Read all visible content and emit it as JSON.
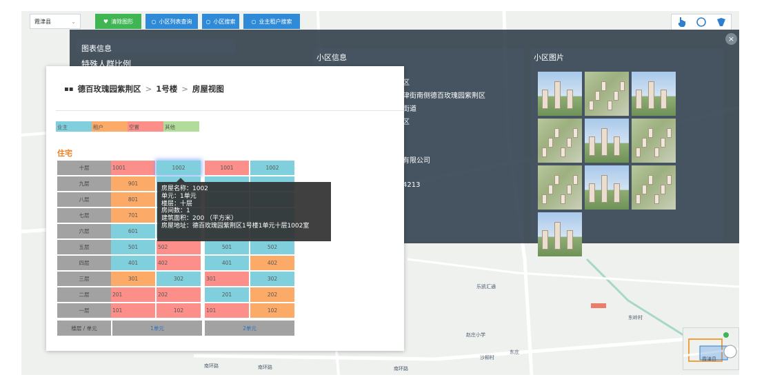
{
  "toolbar": {
    "county": "霞津县",
    "clear_label": "清除图形",
    "list_query_label": "小区列表查询",
    "search_label": "小区搜索",
    "owner_search_label": "业主租户搜索"
  },
  "map_labels": [
    "霞津县",
    "南环路",
    "南环路",
    "南环路",
    "乐凯汇通",
    "赵庄小学",
    "东岭村",
    "沙柳村",
    "东庄",
    "霞津县"
  ],
  "overlay": {
    "chart_info_title": "图表信息",
    "chart_info_subtitle": "特殊人群比例",
    "community_info_title": "小区信息",
    "community_photos_title": "小区图片",
    "info_lines": [
      "区",
      "津街南侧德百玫瑰园紫荆区",
      "街道",
      "区",
      "有限公司",
      "4213"
    ]
  },
  "breadcrumb": {
    "community": "德百玫瑰园紫荆区",
    "building": "1号楼",
    "view": "房屋视图"
  },
  "legend": [
    {
      "label": "业主",
      "color": "#7fd0dc"
    },
    {
      "label": "租户",
      "color": "#fcaa67"
    },
    {
      "label": "空置",
      "color": "#fd8f8a"
    },
    {
      "label": "其他",
      "color": "#b1dc99"
    }
  ],
  "section_title": "住宅",
  "floors": [
    "十层",
    "九层",
    "八层",
    "七层",
    "六层",
    "五层",
    "四层",
    "三层",
    "二层",
    "一层"
  ],
  "room_grid": [
    [
      [
        "1001",
        "vacant",
        "left"
      ],
      [
        "1002",
        "owner",
        "center"
      ],
      [
        "1001",
        "vacant",
        "center"
      ],
      [
        "1002",
        "owner",
        "center"
      ]
    ],
    [
      [
        "901",
        "tenant",
        "center"
      ],
      [
        "",
        "owner",
        "center"
      ],
      [
        "",
        "owner",
        "center"
      ],
      [
        "",
        "owner",
        "center"
      ]
    ],
    [
      [
        "801",
        "tenant",
        "center"
      ],
      [
        "",
        "owner",
        "center"
      ],
      [
        "",
        "owner",
        "center"
      ],
      [
        "",
        "owner",
        "center"
      ]
    ],
    [
      [
        "701",
        "tenant",
        "center"
      ],
      [
        "",
        "owner",
        "center"
      ],
      [
        "",
        "owner",
        "center"
      ],
      [
        "",
        "owner",
        "center"
      ]
    ],
    [
      [
        "601",
        "owner",
        "center"
      ],
      [
        "",
        "owner",
        "center"
      ],
      [
        "",
        "owner",
        "center"
      ],
      [
        "",
        "owner",
        "center"
      ]
    ],
    [
      [
        "501",
        "owner",
        "center"
      ],
      [
        "502",
        "vacant",
        "left"
      ],
      [
        "501",
        "owner",
        "center"
      ],
      [
        "502",
        "owner",
        "center"
      ]
    ],
    [
      [
        "401",
        "owner",
        "center"
      ],
      [
        "402",
        "vacant",
        "left"
      ],
      [
        "401",
        "owner",
        "center"
      ],
      [
        "402",
        "tenant",
        "center"
      ]
    ],
    [
      [
        "301",
        "tenant",
        "center"
      ],
      [
        "302",
        "owner",
        "center"
      ],
      [
        "301",
        "vacant",
        "left"
      ],
      [
        "302",
        "owner",
        "center"
      ]
    ],
    [
      [
        "201",
        "vacant",
        "left"
      ],
      [
        "202",
        "vacant",
        "left"
      ],
      [
        "201",
        "owner",
        "center"
      ],
      [
        "202",
        "tenant",
        "center"
      ]
    ],
    [
      [
        "101",
        "vacant",
        "left"
      ],
      [
        "102",
        "vacant",
        "center"
      ],
      [
        "101",
        "vacant",
        "left"
      ],
      [
        "102",
        "tenant",
        "center"
      ]
    ]
  ],
  "footer": {
    "corner": "楼层 / 单元",
    "units": [
      "1单元",
      "2单元"
    ]
  },
  "tooltip": {
    "lines": [
      "房屋名称：1002",
      "单元：1单元",
      "楼层：十层",
      "房间数：1",
      "建筑面积：200 （平方米）",
      "房屋地址：德百玫瑰园紫荆区1号楼1单元十层1002室"
    ]
  }
}
